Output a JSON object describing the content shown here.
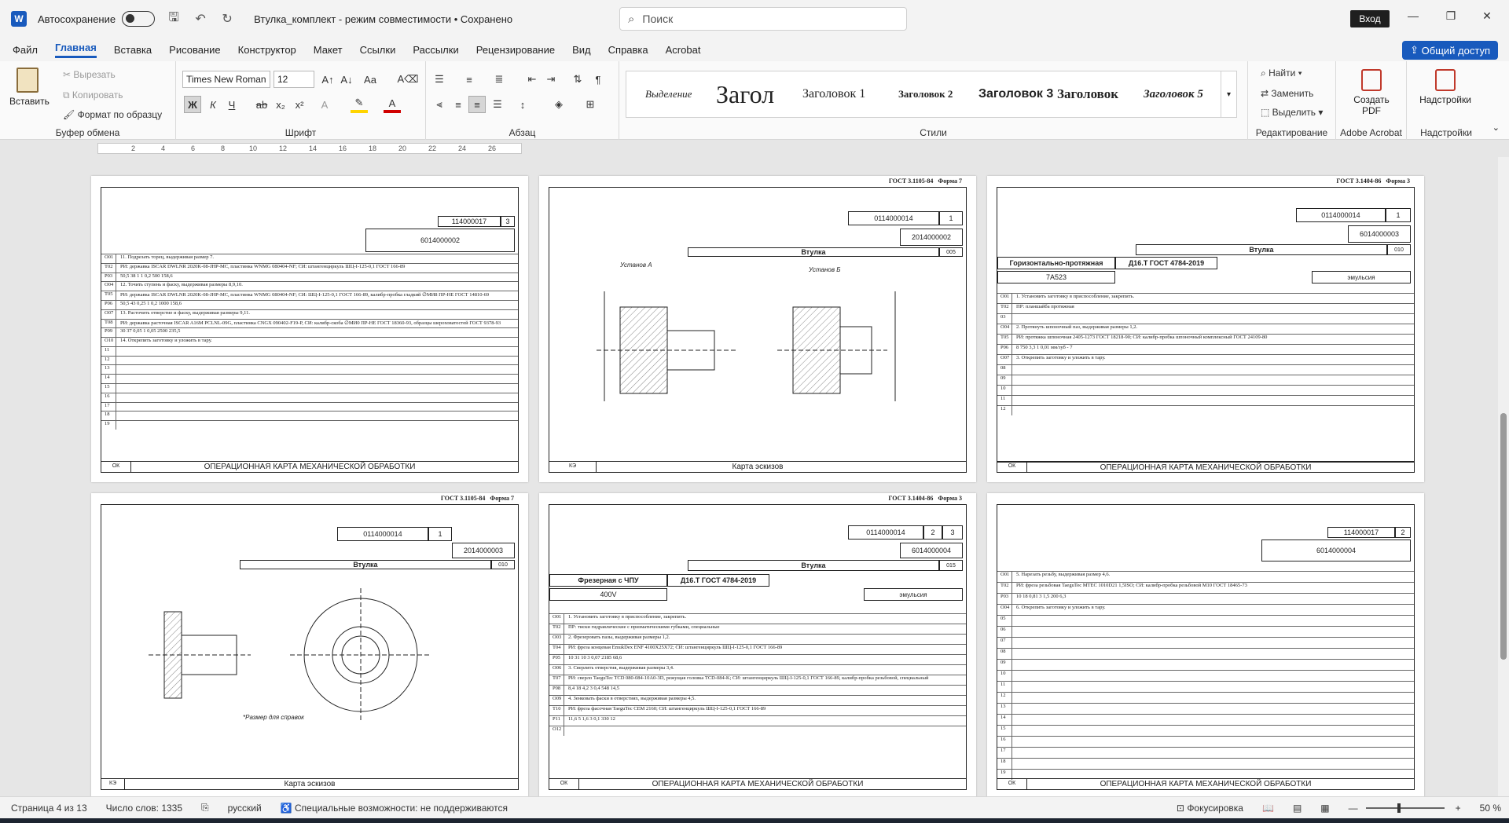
{
  "app": {
    "logo": "W",
    "autosave_label": "Автосохранение",
    "doc_title": "Втулка_комплект - режим совместимости • Сохранено",
    "search_placeholder": "Поиск",
    "signin": "Вход",
    "share": "Общий доступ"
  },
  "menu": [
    "Файл",
    "Главная",
    "Вставка",
    "Рисование",
    "Конструктор",
    "Макет",
    "Ссылки",
    "Рассылки",
    "Рецензирование",
    "Вид",
    "Справка",
    "Acrobat"
  ],
  "ribbon": {
    "clipboard": {
      "paste": "Вставить",
      "cut": "Вырезать",
      "copy": "Копировать",
      "format_painter": "Формат по образцу",
      "label": "Буфер обмена"
    },
    "font": {
      "name": "Times New Roman",
      "size": "12",
      "label": "Шрифт",
      "bold": "Ж",
      "italic": "К",
      "underline": "Ч",
      "strike": "ab",
      "sub": "x₂",
      "sup": "x²"
    },
    "paragraph": {
      "label": "Абзац"
    },
    "styles": {
      "label": "Стили",
      "items": [
        "Выделение",
        "Загол",
        "Заголовок 1",
        "Заголовок 2",
        "Заголовок 3",
        "Заголовок",
        "Заголовок 5"
      ]
    },
    "editing": {
      "find": "Найти",
      "replace": "Заменить",
      "select": "Выделить",
      "label": "Редактирование"
    },
    "acrobat": {
      "create_pdf": "Создать PDF",
      "label": "Adobe Acrobat"
    },
    "addins": {
      "button": "Надстройки",
      "label": "Надстройки"
    }
  },
  "ruler": [
    "2",
    "4",
    "6",
    "8",
    "10",
    "12",
    "14",
    "16",
    "18",
    "20",
    "22",
    "24",
    "26"
  ],
  "pages": {
    "p1": {
      "code_top": "114000017",
      "sheet": "3",
      "code_main": "6014000002",
      "title": "ОПЕРАЦИОННАЯ КАРТА МЕХАНИЧЕСКОЙ ОБРАБОТКИ",
      "ok": "ОК",
      "rows": [
        {
          "n": "О01",
          "t": "11. Подрезать торец, выдерживая размер 7."
        },
        {
          "n": "Т02",
          "t": "РИ: державка ISCAR DWLNR 2020K-08-JHP-MC, пластинка WNMG 080404-NF; СИ: штангенциркуль ШЦ-I-125-0,1 ГОСТ 166-89"
        },
        {
          "n": "Р03",
          "t": "50,5    38    1    1    0,2    500    158,6"
        },
        {
          "n": "О04",
          "t": "12. Точить ступень и фаску, выдерживая размеры 8,9,10."
        },
        {
          "n": "Т05",
          "t": "РИ: державка ISCAR DWLNR 2020K-08-JHP-MC, пластинка WNMG 080404-NF; СИ: ШЦ-I-125-0,1 ГОСТ 166-89, калибр-пробка гладкий ∅МИ8 ПР-НЕ ГОСТ 14810-69"
        },
        {
          "n": "Р06",
          "t": "50,5    43    0,25    1    0,2    1000    158,6"
        },
        {
          "n": "О07",
          "t": "13. Расточить отверстие и фаску, выдерживая размеры 9,11."
        },
        {
          "n": "Т08",
          "t": "РИ: державка расточная ISCAR A16M PCLNL-09G, пластинка CNGX 090402-F19-P, СИ: калибр-скоба ∅МИ0 ПР-НЕ ГОСТ 18360-93, образцы шероховатостей ГОСТ 9378-93"
        },
        {
          "n": "Р09",
          "t": "30    37    0,05    1    0,05    2500    235,5"
        },
        {
          "n": "О10",
          "t": "14. Открепить заготовку и уложить в тару."
        },
        {
          "n": "11",
          "t": ""
        },
        {
          "n": "12",
          "t": ""
        },
        {
          "n": "13",
          "t": ""
        },
        {
          "n": "14",
          "t": ""
        },
        {
          "n": "15",
          "t": ""
        },
        {
          "n": "16",
          "t": ""
        },
        {
          "n": "17",
          "t": ""
        },
        {
          "n": "18",
          "t": ""
        },
        {
          "n": "19",
          "t": ""
        }
      ]
    },
    "p2": {
      "gost": "ГОСТ 3.1105-84",
      "form": "Форма 7",
      "code_top": "0114000014",
      "sheet": "1",
      "code_main": "2014000002",
      "part": "Втулка",
      "num": "005",
      "setup_a": "Установ А",
      "setup_b": "Установ Б",
      "title": "Карта эскизов",
      "ke": "КЭ"
    },
    "p3": {
      "gost": "ГОСТ 3.1404-86",
      "form": "Форма 3",
      "code_top": "0114000014",
      "sheet": "1",
      "code_main": "6014000003",
      "part": "Втулка",
      "num": "010",
      "operation": "Горизонтально-протяжная",
      "material": "Д16.Т ГОСТ 4784-2019",
      "machine": "7А523",
      "coolant": "эмульсия",
      "title": "ОПЕРАЦИОННАЯ КАРТА МЕХАНИЧЕСКОЙ ОБРАБОТКИ",
      "ok": "ОК",
      "rows": [
        {
          "n": "О01",
          "t": "1. Установить заготовку в приспособление, закрепить."
        },
        {
          "n": "Т02",
          "t": "ПР: планшайба протяжная"
        },
        {
          "n": "03",
          "t": ""
        },
        {
          "n": "О04",
          "t": "2. Протянуть шпоночный паз, выдерживая размеры 1,2."
        },
        {
          "n": "Т05",
          "t": "РИ: протяжка шпоночная 2405-1273 ГОСТ 18218-90; СИ: калибр-пробка шпоночный комплексный ГОСТ 24109-80"
        },
        {
          "n": "Р06",
          "t": "8    750    3,3    1    0,01 мм/зуб    -    7"
        },
        {
          "n": "О07",
          "t": "3. Открепить заготовку и уложить в тару."
        },
        {
          "n": "08",
          "t": ""
        },
        {
          "n": "09",
          "t": ""
        },
        {
          "n": "10",
          "t": ""
        },
        {
          "n": "11",
          "t": ""
        },
        {
          "n": "12",
          "t": ""
        }
      ]
    },
    "p4": {
      "gost": "ГОСТ 3.1105-84",
      "form": "Форма 7",
      "code_top": "0114000014",
      "sheet": "1",
      "code_main": "2014000003",
      "part": "Втулка",
      "num": "010",
      "note": "*Размер для справок",
      "title": "Карта эскизов",
      "ke": "КЭ"
    },
    "p5": {
      "gost": "ГОСТ 3.1404-86",
      "form": "Форма 3",
      "code_top": "0114000014",
      "sheet": "2",
      "sheet2": "3",
      "code_main": "6014000004",
      "part": "Втулка",
      "num": "015",
      "operation": "Фрезерная с ЧПУ",
      "material": "Д16.Т ГОСТ 4784-2019",
      "machine": "400V",
      "coolant": "эмульсия",
      "title": "ОПЕРАЦИОННАЯ КАРТА МЕХАНИЧЕСКОЙ ОБРАБОТКИ",
      "ok": "ОК",
      "rows": [
        {
          "n": "О01",
          "t": "1. Установить заготовку в приспособление, закрепить."
        },
        {
          "n": "Т02",
          "t": "ПР: тиски гидравлические с призматическими губками, специальные"
        },
        {
          "n": "О03",
          "t": "2. Фрезеровать пазы, выдерживая размеры 1,2."
        },
        {
          "n": "Т04",
          "t": "РИ: фреза концевая EmukDex ENF 4100X25X72; СИ: штангенциркуль ШЦ-I-125-0,1 ГОСТ 166-89"
        },
        {
          "n": "Р05",
          "t": "10    31    10    3    0,07    2185    68,6"
        },
        {
          "n": "О06",
          "t": "3. Сверлить отверстия, выдерживая размеры 3,4."
        },
        {
          "n": "Т07",
          "t": "РИ: сверло TaeguTec TCD 080-084-10A0-3D, режущая головка TCD-084-K; СИ: штангенциркуль ШЦ-I-125-0,1 ГОСТ 166-89, калибр-пробка резьбовой, специальный"
        },
        {
          "n": "Р08",
          "t": "8,4    18    4,2    3    0,4    548    14,5"
        },
        {
          "n": "О09",
          "t": "4. Зенковать фаски в отверстиях, выдерживая размеры 4,5."
        },
        {
          "n": "Т10",
          "t": "РИ: фреза фасочная TaeguTec CEM 2160; СИ: штангенциркуль ШЦ-I-125-0,1 ГОСТ 166-89"
        },
        {
          "n": "Р11",
          "t": "11,6    5    1,6    3    0,1    330    12"
        },
        {
          "n": "О12",
          "t": ""
        }
      ]
    },
    "p6": {
      "code_top": "114000017",
      "sheet": "2",
      "code_main": "6014000004",
      "title": "ОПЕРАЦИОННАЯ КАРТА МЕХАНИЧЕСКОЙ ОБРАБОТКИ",
      "ok": "ОК",
      "rows": [
        {
          "n": "О01",
          "t": "5. Нарезать резьбу, выдерживая размер 4,6."
        },
        {
          "n": "Т02",
          "t": "РИ: фреза резьбовая TaeguTec MTEC 1010D21 1,5ISO; СИ: калибр-пробка резьбовой М10 ГОСТ 18465-73"
        },
        {
          "n": "Р03",
          "t": "10    18    0,81    3    1,5    200    6,3"
        },
        {
          "n": "О04",
          "t": "6. Открепить заготовку и уложить в тару."
        },
        {
          "n": "05",
          "t": ""
        },
        {
          "n": "06",
          "t": ""
        },
        {
          "n": "07",
          "t": ""
        },
        {
          "n": "08",
          "t": ""
        },
        {
          "n": "09",
          "t": ""
        },
        {
          "n": "10",
          "t": ""
        },
        {
          "n": "11",
          "t": ""
        },
        {
          "n": "12",
          "t": ""
        },
        {
          "n": "13",
          "t": ""
        },
        {
          "n": "14",
          "t": ""
        },
        {
          "n": "15",
          "t": ""
        },
        {
          "n": "16",
          "t": ""
        },
        {
          "n": "17",
          "t": ""
        },
        {
          "n": "18",
          "t": ""
        },
        {
          "n": "19",
          "t": ""
        }
      ]
    }
  },
  "status": {
    "page": "Страница 4 из 13",
    "words": "Число слов: 1335",
    "lang": "русский",
    "accessibility": "Специальные возможности: не поддерживаются",
    "focus": "Фокусировка",
    "zoom": "50 %"
  }
}
